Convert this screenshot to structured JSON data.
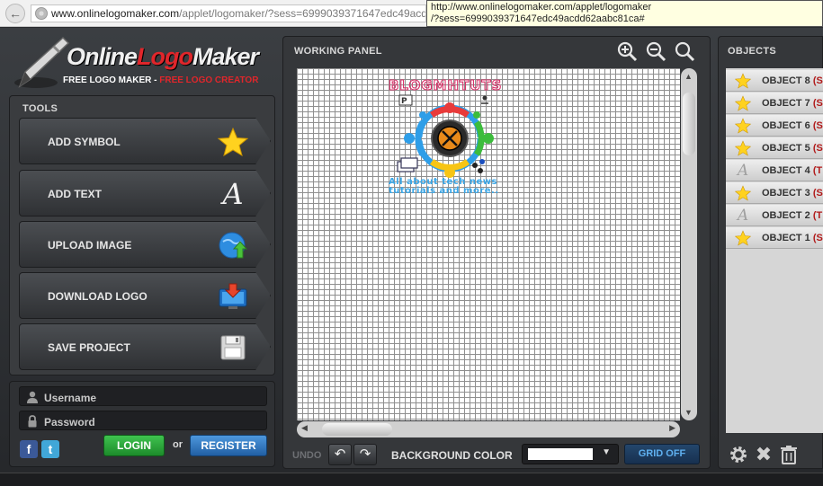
{
  "browser": {
    "url_host": "www.onlinelogomaker.com",
    "url_rest": "/applet/logomaker/?sess=6999039371647edc49acdd62aabc",
    "tooltip_line1": "http://www.onlinelogomaker.com/applet/logomaker",
    "tooltip_line2": "/?sess=6999039371647edc49acdd62aabc81ca#"
  },
  "brand": {
    "name_part1": "Online",
    "name_part2": "Logo",
    "name_part3": "Maker",
    "sub_white": "FREE LOGO MAKER - ",
    "sub_red": "FREE LOGO CREATOR"
  },
  "tools": {
    "heading": "TOOLS",
    "items": [
      {
        "label": "ADD SYMBOL",
        "icon": "star-icon"
      },
      {
        "label": "ADD TEXT",
        "icon": "letter-a-icon"
      },
      {
        "label": "UPLOAD IMAGE",
        "icon": "upload-globe-icon"
      },
      {
        "label": "DOWNLOAD LOGO",
        "icon": "download-monitor-icon"
      },
      {
        "label": "SAVE PROJECT",
        "icon": "floppy-disk-icon"
      }
    ]
  },
  "login": {
    "username_label": "Username",
    "password_label": "Password",
    "facebook": "f",
    "twitter": "t",
    "login_button": "LOGIN",
    "or": "or",
    "register_button": "REGISTER"
  },
  "working_panel": {
    "heading": "WORKING PANEL",
    "logo_title": "BLOGMHTUTS",
    "logo_tagline1": "All about tech news",
    "logo_tagline2": "tutorials and more..",
    "undo_label": "UNDO",
    "background_color_label": "BACKGROUND COLOR",
    "background_color_value": "#ffffff",
    "grid_button": "GRID OFF"
  },
  "objects_panel": {
    "heading": "OBJECTS",
    "items": [
      {
        "name": "OBJECT 8",
        "type": "(S",
        "icon": "star-icon"
      },
      {
        "name": "OBJECT 7",
        "type": "(S",
        "icon": "star-icon"
      },
      {
        "name": "OBJECT 6",
        "type": "(S",
        "icon": "star-icon"
      },
      {
        "name": "OBJECT 5",
        "type": "(S",
        "icon": "star-icon"
      },
      {
        "name": "OBJECT 4",
        "type": "(T",
        "icon": "letter-a-icon"
      },
      {
        "name": "OBJECT 3",
        "type": "(S",
        "icon": "star-icon"
      },
      {
        "name": "OBJECT 2",
        "type": "(T",
        "icon": "letter-a-icon"
      },
      {
        "name": "OBJECT 1",
        "type": "(S",
        "icon": "star-icon"
      }
    ]
  },
  "colors": {
    "accent_red": "#e0262b",
    "login_green": "#2aa63a",
    "register_blue": "#2f76c0",
    "grid_text": "#5fb0f0"
  }
}
